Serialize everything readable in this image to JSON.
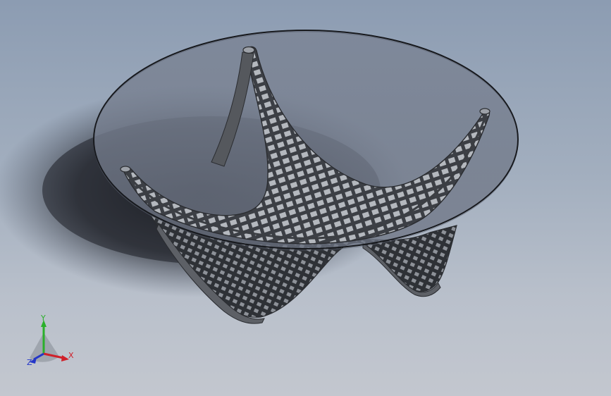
{
  "viewport": {
    "background_top": "#8c9cb2",
    "background_bottom": "#c3c7cf"
  },
  "model": {
    "glass_color": "#7e8796",
    "frame_color": "#55585d",
    "rib_color": "#a8acb2",
    "shadow_color": "#1a1c22"
  },
  "triad": {
    "x_label": "X",
    "y_label": "Y",
    "z_label": "Z",
    "x_color": "#d0202a",
    "y_color": "#2bb02b",
    "z_color": "#2436c8"
  }
}
